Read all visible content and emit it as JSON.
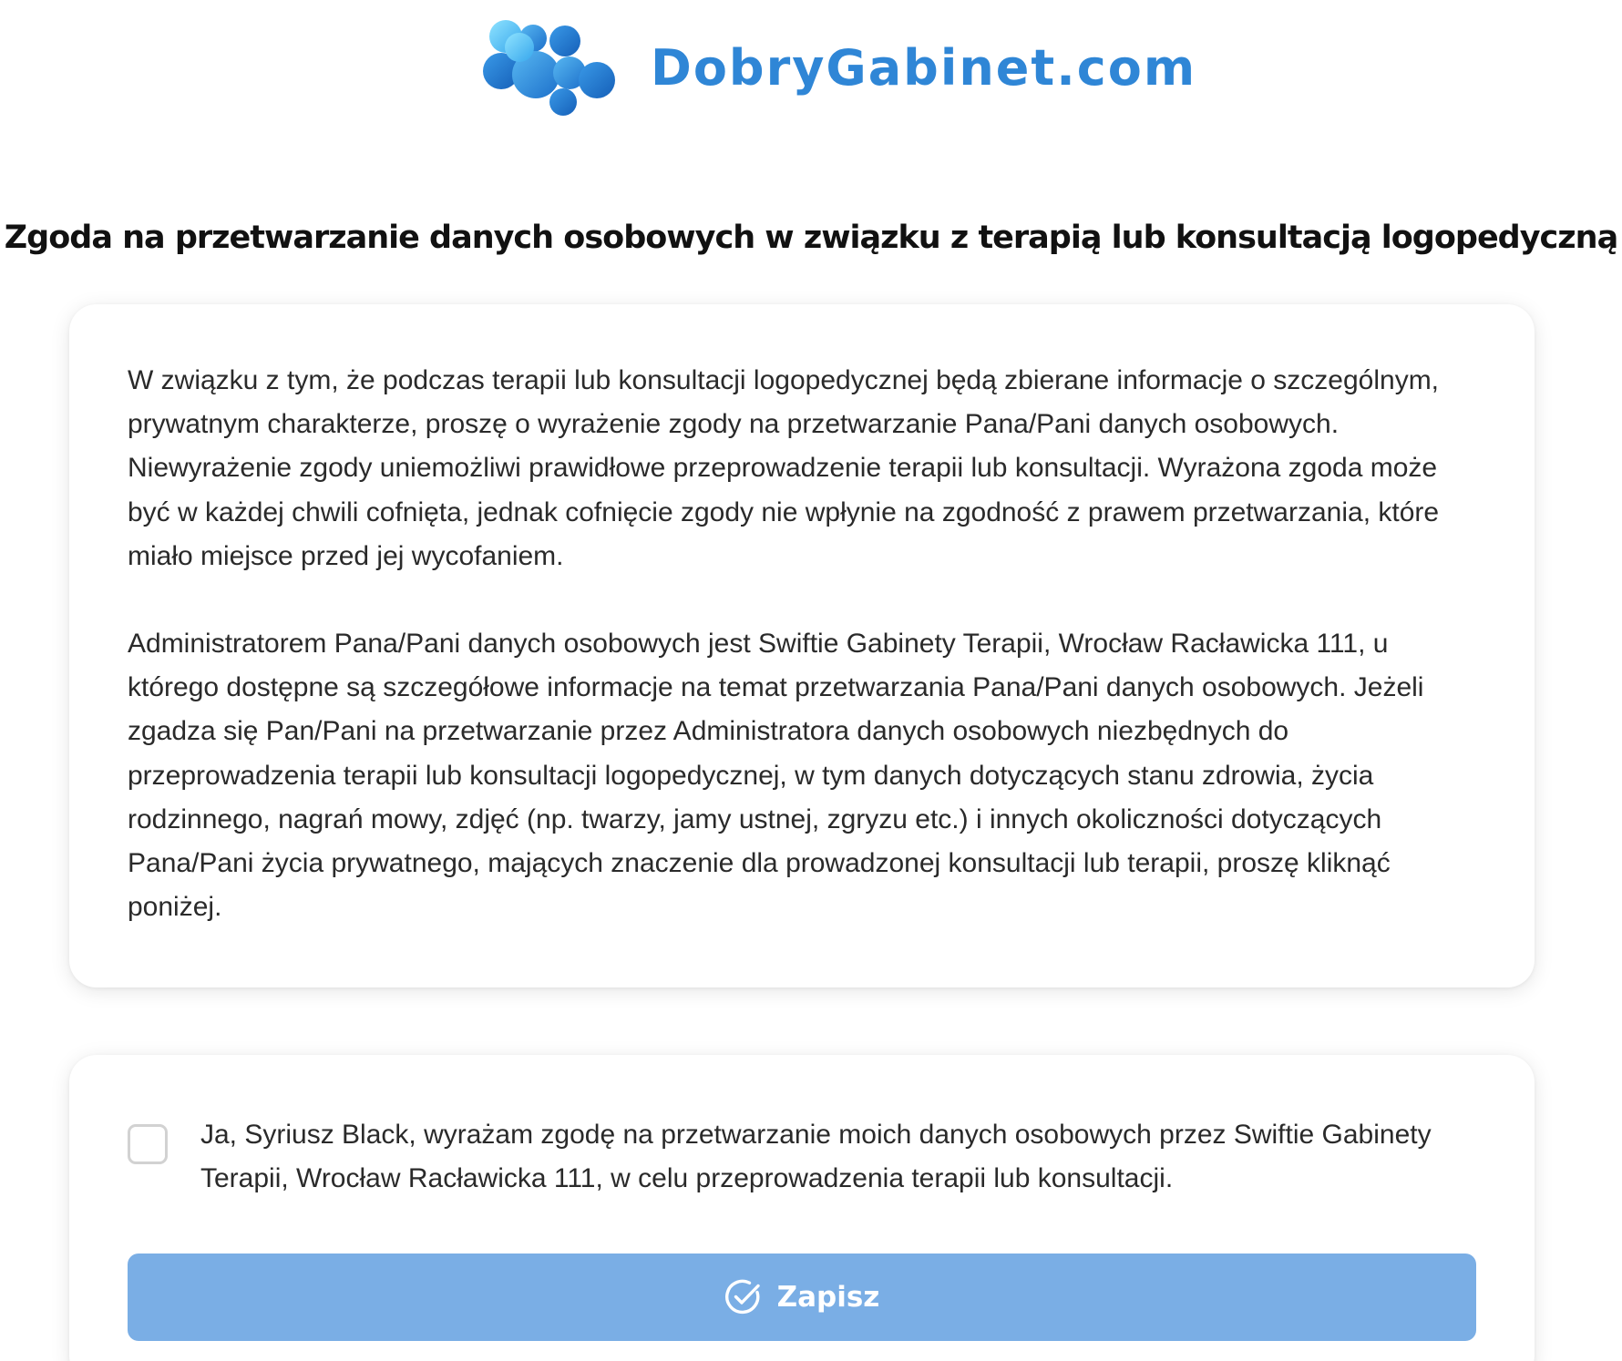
{
  "header": {
    "brand_name": "DobryGabinet.com",
    "logo_icon": "bubbles-logo-icon"
  },
  "page_title": "Zgoda na przetwarzanie danych osobowych w związku z terapią lub konsultacją logopedyczną",
  "info_card": {
    "paragraph_1": "W związku z tym, że podczas terapii lub konsultacji logopedycznej będą zbierane informacje o szczególnym, prywatnym charakterze, proszę o wyrażenie zgody na przetwarzanie Pana/Pani danych osobowych. Niewyrażenie zgody uniemożliwi prawidłowe przeprowadzenie terapii lub konsultacji. Wyrażona zgoda może być w każdej chwili cofnięta, jednak cofnięcie zgody nie wpłynie na zgodność z prawem przetwarzania, które miało miejsce przed jej wycofaniem.",
    "paragraph_2": "Administratorem Pana/Pani danych osobowych jest Swiftie Gabinety Terapii, Wrocław Racławicka 111, u którego dostępne są szczegółowe informacje na temat przetwarzania Pana/Pani danych osobowych. Jeżeli zgadza się Pan/Pani na przetwarzanie przez Administratora danych osobowych niezbędnych do przeprowadzenia terapii lub konsultacji logopedycznej, w tym danych dotyczących stanu zdrowia, życia rodzinnego, nagrań mowy, zdjęć (np. twarzy, jamy ustnej, zgryzu etc.) i innych okoliczności dotyczących Pana/Pani życia prywatnego, mających znaczenie dla prowadzonej konsultacji lub terapii, proszę kliknąć poniżej."
  },
  "consent": {
    "checked": false,
    "text": "Ja, Syriusz Black, wyrażam zgodę na przetwarzanie moich danych osobowych przez Swiftie Gabinety Terapii, Wrocław Racławicka 111, w celu przeprowadzenia terapii lub konsultacji.",
    "save_label": "Zapisz",
    "save_icon": "check-circle-icon"
  },
  "colors": {
    "brand_blue": "#2f86d6",
    "button_blue": "#7aaee5",
    "checkbox_border": "#d2d2d2"
  }
}
